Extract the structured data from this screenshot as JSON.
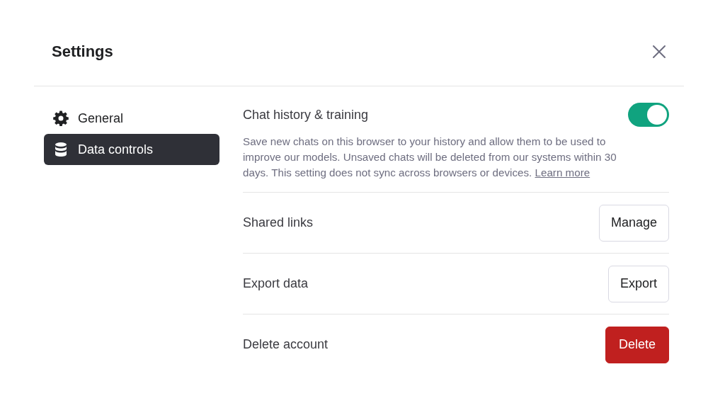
{
  "title": "Settings",
  "sidebar": {
    "items": [
      {
        "label": "General",
        "kind": "gear",
        "selected": false
      },
      {
        "label": "Data controls",
        "kind": "database",
        "selected": true
      }
    ]
  },
  "settings": [
    {
      "kind": "toggle",
      "label": "Chat history & training",
      "on": true,
      "description": "Save new chats on this browser to your history and allow them to be used to improve our models. Unsaved chats will be deleted from our systems within 30 days. This setting does not sync across browsers or devices.",
      "link": "Learn more"
    },
    {
      "kind": "button",
      "label": "Shared links",
      "button": "Manage"
    },
    {
      "kind": "button",
      "label": "Export data",
      "button": "Export"
    },
    {
      "kind": "danger",
      "label": "Delete account",
      "button": "Delete"
    }
  ]
}
